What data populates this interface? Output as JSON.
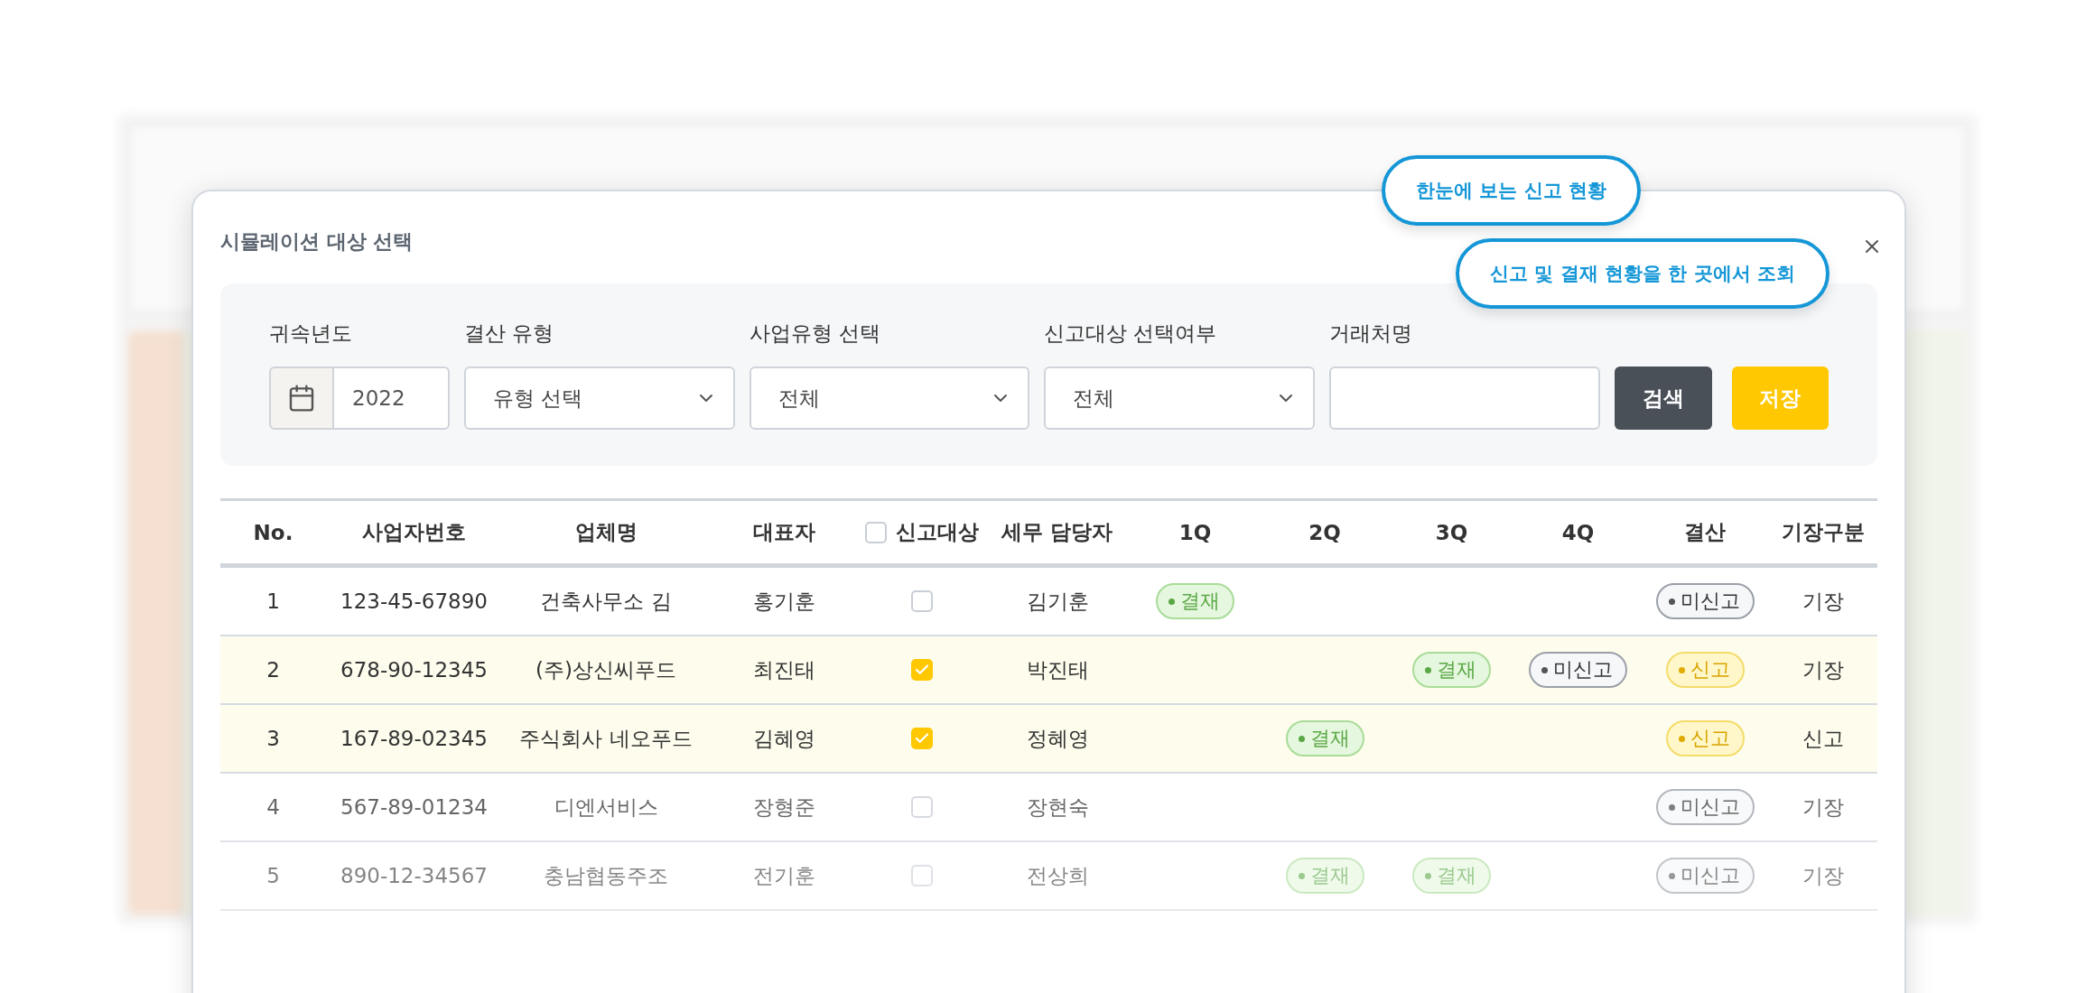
{
  "modal": {
    "title": "시뮬레이션 대상 선택",
    "callouts": [
      "한눈에 보는 신고 현황",
      "신고 및 결재 현황을 한 곳에서 조회"
    ],
    "filters": {
      "year": {
        "label": "귀속년도",
        "value": "2022"
      },
      "selects": [
        {
          "label": "결산 유형",
          "value": "유형 선택"
        },
        {
          "label": "사업유형 선택",
          "value": "전체"
        },
        {
          "label": "신고대상 선택여부",
          "value": "전체"
        }
      ],
      "partner": {
        "label": "거래처명"
      },
      "buttons": [
        {
          "kind": "search",
          "label": "검색"
        },
        {
          "kind": "save",
          "label": "저장"
        }
      ]
    },
    "table": {
      "columns": [
        "No.",
        "사업자번호",
        "업체명",
        "대표자",
        "신고대상",
        "세무 담당자",
        "1Q",
        "2Q",
        "3Q",
        "4Q",
        "결산",
        "기장구분"
      ],
      "header_checkbox": {
        "checked": false
      },
      "rows": [
        {
          "no": "1",
          "biz_no": "123-45-67890",
          "company": "건축사무소 김",
          "ceo": "홍기훈",
          "checked": false,
          "manager": "김기훈",
          "quarters": {
            "q1": {
              "kind": "paid",
              "label": "결재"
            }
          },
          "settlement": {
            "kind": "unfiled",
            "label": "미신고"
          },
          "bookkeeping": "기장"
        },
        {
          "no": "2",
          "biz_no": "678-90-12345",
          "company": "(주)상신씨푸드",
          "ceo": "최진태",
          "checked": true,
          "manager": "박진태",
          "quarters": {
            "q3": {
              "kind": "paid",
              "label": "결재"
            },
            "q4": {
              "kind": "unfiled",
              "label": "미신고"
            }
          },
          "settlement": {
            "kind": "filed",
            "label": "신고"
          },
          "bookkeeping": "기장"
        },
        {
          "no": "3",
          "biz_no": "167-89-02345",
          "company": "주식회사 네오푸드",
          "ceo": "김혜영",
          "checked": true,
          "manager": "정혜영",
          "quarters": {
            "q2": {
              "kind": "paid",
              "label": "결재"
            }
          },
          "settlement": {
            "kind": "filed",
            "label": "신고"
          },
          "bookkeeping": "신고"
        },
        {
          "no": "4",
          "biz_no": "567-89-01234",
          "company": "디엔서비스",
          "ceo": "장형준",
          "checked": false,
          "manager": "장현숙",
          "settlement": {
            "kind": "unfiled",
            "label": "미신고"
          },
          "bookkeeping": "기장"
        },
        {
          "no": "5",
          "biz_no": "890-12-34567",
          "company": "충남협동주조",
          "ceo": "전기훈",
          "checked": false,
          "manager": "전상희",
          "quarters": {
            "q2": {
              "kind": "paid",
              "label": "결재"
            },
            "q3": {
              "kind": "paid",
              "label": "결재"
            }
          },
          "settlement": {
            "kind": "unfiled",
            "label": "미신고"
          },
          "bookkeeping": "기장"
        }
      ]
    }
  }
}
